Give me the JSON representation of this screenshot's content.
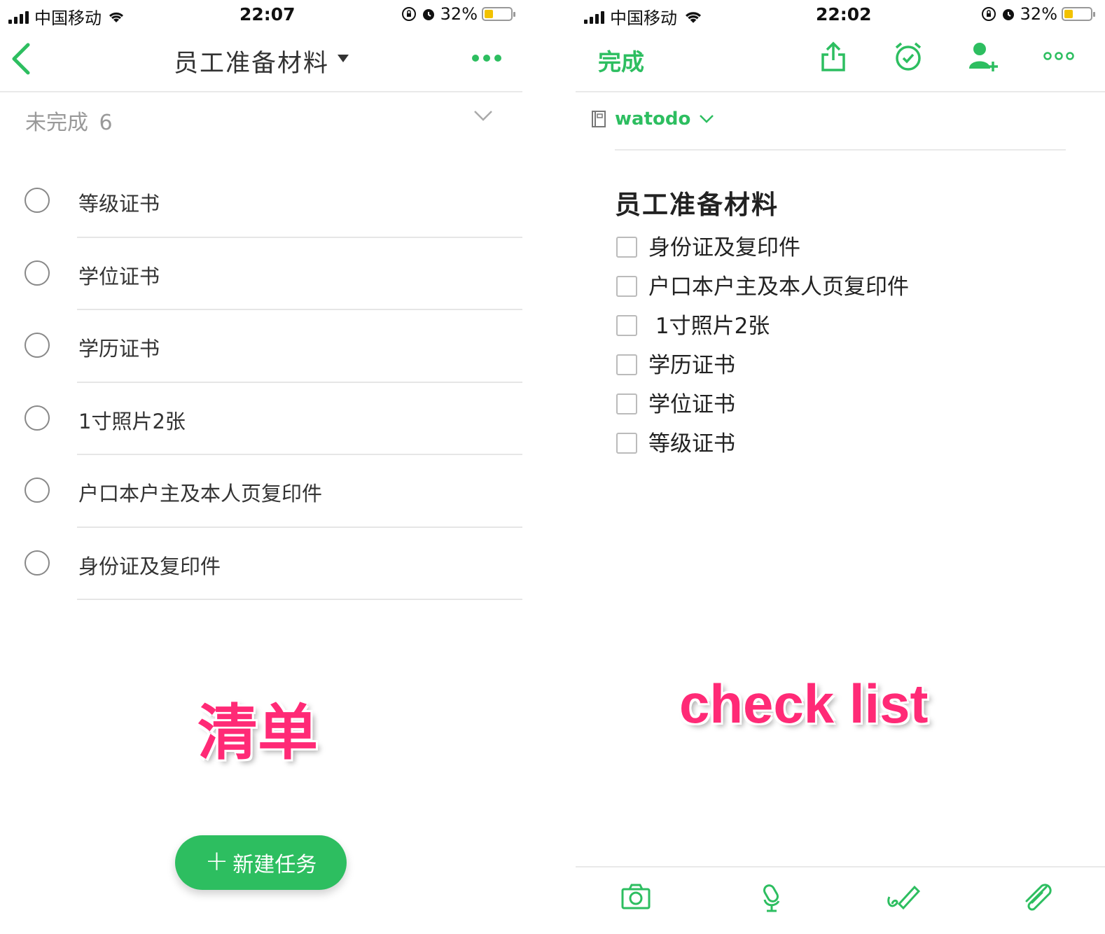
{
  "left": {
    "status": {
      "carrier": "中国移动",
      "time": "22:07",
      "battery": "32%"
    },
    "header": {
      "title": "员工准备材料"
    },
    "section": {
      "label": "未完成",
      "count": "6"
    },
    "tasks": [
      {
        "label": "等级证书"
      },
      {
        "label": "学位证书"
      },
      {
        "label": "学历证书"
      },
      {
        "label": "1寸照片2张"
      },
      {
        "label": "户口本户主及本人页复印件"
      },
      {
        "label": "身份证及复印件"
      }
    ],
    "caption": "清单",
    "new_task_label": "新建任务"
  },
  "right": {
    "status": {
      "carrier": "中国移动",
      "time": "22:02",
      "battery": "32%"
    },
    "header": {
      "done_label": "完成"
    },
    "notebook": {
      "name": "watodo"
    },
    "note": {
      "title": "员工准备材料",
      "checklist": [
        {
          "label": "身份证及复印件"
        },
        {
          "label": "户口本户主及本人页复印件"
        },
        {
          "label": " 1寸照片2张"
        },
        {
          "label": "学历证书"
        },
        {
          "label": "学位证书"
        },
        {
          "label": "等级证书"
        }
      ]
    },
    "caption": "check list"
  },
  "colors": {
    "accent": "#2dbe60",
    "caption": "#ff2a76"
  },
  "icons": [
    "back-icon",
    "more-icon",
    "chevron-down-icon",
    "share-icon",
    "alarm-icon",
    "add-user-icon",
    "notebook-icon",
    "camera-icon",
    "microphone-icon",
    "sketch-icon",
    "attachment-icon"
  ]
}
